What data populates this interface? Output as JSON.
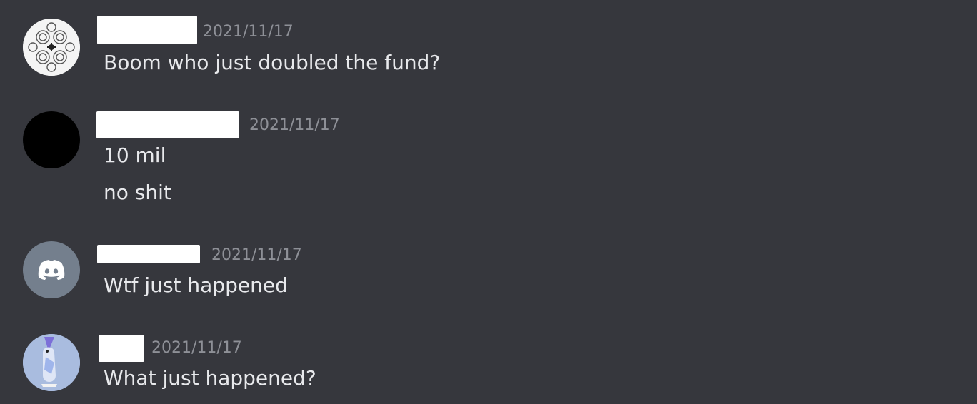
{
  "colors": {
    "background": "#36373d",
    "timestamp": "#8e9097",
    "message_text": "#e8e9ec",
    "discord_avatar_bg": "#747f8d",
    "name_redaction": "#ffffff"
  },
  "messages": [
    {
      "avatar": "fractal-avatar-icon",
      "timestamp": "2021/11/17",
      "lines": [
        "Boom who just doubled the fund?"
      ]
    },
    {
      "avatar": "black-avatar-icon",
      "timestamp": "2021/11/17",
      "lines": [
        "10 mil",
        "no shit"
      ]
    },
    {
      "avatar": "discord-default-avatar-icon",
      "timestamp": "2021/11/17",
      "lines": [
        "Wtf just happened"
      ]
    },
    {
      "avatar": "penguin-wizard-avatar-icon",
      "timestamp": "2021/11/17",
      "lines": [
        "What just happened?"
      ]
    }
  ]
}
